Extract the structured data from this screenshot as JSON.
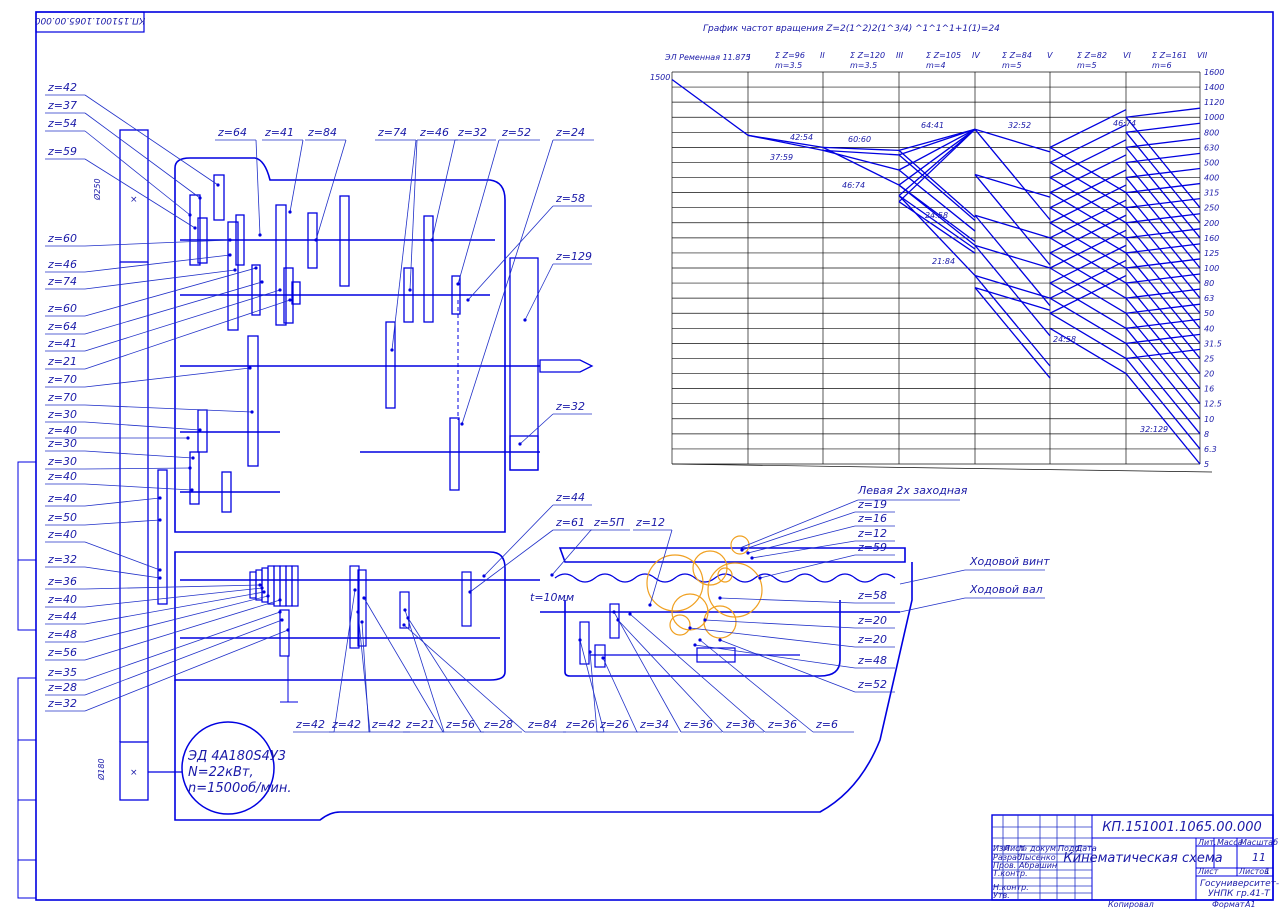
{
  "drawing_code_top": "КП.151001.1065.00.000",
  "chart": {
    "title": "График частот вращения  Z=2(1^2)2(1^3/4) ^1^1^1+1(1)=24",
    "header_first": "ЭЛ Ременная 11.875",
    "header_I": "I",
    "shaft_headers": [
      {
        "roman": "II",
        "sum": "Σ Z=96",
        "m": "m=3.5"
      },
      {
        "roman": "III",
        "sum": "Σ Z=120",
        "m": "m=3.5"
      },
      {
        "roman": "IV",
        "sum": "Σ Z=105",
        "m": "m=4"
      },
      {
        "roman": "V",
        "sum": "Σ Z=84",
        "m": "m=5"
      },
      {
        "roman": "VI",
        "sum": "Σ Z=82",
        "m": "m=5"
      },
      {
        "roman": "VII",
        "sum": "Σ Z=161",
        "m": "m=6"
      }
    ],
    "motor_speed": "1500",
    "speeds": [
      "1600",
      "1400",
      "1120",
      "1000",
      "800",
      "630",
      "500",
      "400",
      "315",
      "250",
      "200",
      "160",
      "125",
      "100",
      "80",
      "63",
      "50",
      "40",
      "31.5",
      "25",
      "20",
      "16",
      "12.5",
      "10",
      "8",
      "6.3",
      "5"
    ],
    "ratios": {
      "r1": "42:54",
      "r2": "37:59",
      "r3": "60:60",
      "r4": "46:74",
      "r5": "64:41",
      "r6": "32:52",
      "r7": "46:74",
      "r8": "24:58",
      "r9": "21:84",
      "r10": "24:58",
      "r11": "32:129",
      "r12": "46:74"
    }
  },
  "left_labels": [
    "z=42",
    "z=37",
    "z=54",
    "z=59",
    "z=60",
    "z=46",
    "z=74",
    "z=60",
    "z=64",
    "z=41",
    "z=21",
    "z=70",
    "z=70",
    "z=30",
    "z=40",
    "z=30",
    "z=30",
    "z=40",
    "z=40",
    "z=50",
    "z=40",
    "z=32",
    "z=36",
    "z=40",
    "z=44",
    "z=48",
    "z=56",
    "z=35",
    "z=28",
    "z=32"
  ],
  "top_labels": [
    "z=64",
    "z=41",
    "z=84",
    "z=74",
    "z=46",
    "z=32",
    "z=52",
    "z=24"
  ],
  "right_labels": [
    "z=58",
    "z=129",
    "z=32",
    "z=44",
    "z=61",
    "z=5П",
    "z=12"
  ],
  "bottom_labels": [
    "z=42",
    "z=42",
    "z=42",
    "z=21",
    "z=56",
    "z=28",
    "z=84",
    "z=26",
    "z=26",
    "z=34",
    "z=36",
    "z=36",
    "z=36",
    "z=6"
  ],
  "apron_right_labels": [
    "z=19",
    "z=16",
    "z=12",
    "z=59",
    "z=58",
    "z=20",
    "z=20",
    "z=48",
    "z=52"
  ],
  "annotations": {
    "left_screw": "Левая 2х заходная",
    "lead_screw": "Ходовой винт",
    "feed_shaft": "Ходовой вал",
    "pitch": "t=10мм",
    "pulley_top": "Ø250",
    "pulley_bottom": "Ø180"
  },
  "motor": {
    "line1": "ЭД 4А180S4У3",
    "line2": "N=22кВт,",
    "line3": "n=1500об/мин."
  },
  "title_block": {
    "code": "КП.151001.1065.00.000",
    "name": "Кинематическая схема",
    "lit": "Лит.",
    "mass": "Масса",
    "scale": "Масштаб",
    "sheet_num": "11",
    "sheet": "Лист",
    "sheets": "Листов",
    "sheets_count": "1",
    "org1": "Госуниверситет-",
    "org2": "УНПК  гр.41-Т",
    "copied": "Копировал",
    "format": "Формат",
    "format_val": "A1",
    "rows": [
      "Изм",
      "Лист",
      "№ докум.",
      "Подп.",
      "Дата"
    ],
    "roles": [
      "Разраб.",
      "Пров.",
      "Т.контр.",
      "Н.контр.",
      "Утв."
    ],
    "names": [
      "Лысенко",
      "Абрашин"
    ]
  },
  "colors": {
    "line": "#0000e0",
    "grid": "#111111",
    "gear_highlight": "#f0a020"
  }
}
